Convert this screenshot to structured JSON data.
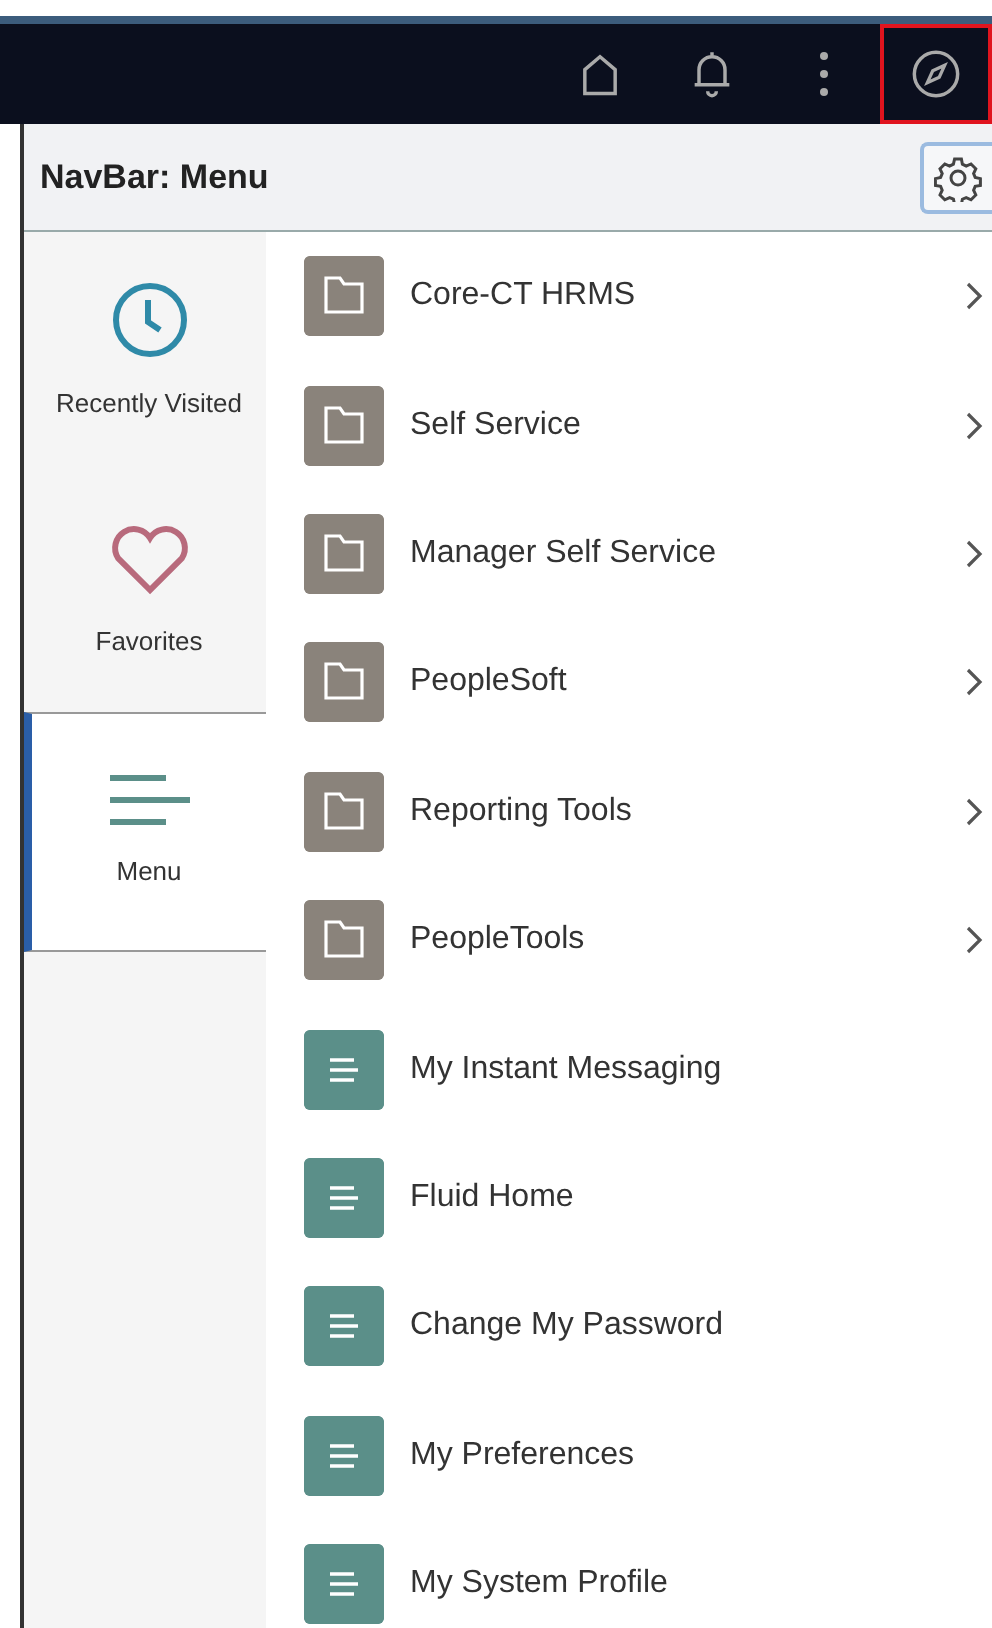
{
  "top_bar": {
    "icons": [
      {
        "kind": "home",
        "highlighted": false
      },
      {
        "kind": "bell",
        "highlighted": false
      },
      {
        "kind": "more",
        "highlighted": false
      },
      {
        "kind": "compass",
        "highlighted": true
      }
    ]
  },
  "header": {
    "title": "NavBar: Menu"
  },
  "sidebar": {
    "items": [
      {
        "kind": "clock",
        "label": "Recently Visited",
        "selected": false
      },
      {
        "kind": "heart",
        "label": "Favorites",
        "selected": false
      },
      {
        "kind": "menu",
        "label": "Menu",
        "selected": true
      }
    ]
  },
  "menu": {
    "items": [
      {
        "kind": "folder",
        "label": "Core-CT HRMS"
      },
      {
        "kind": "folder",
        "label": "Self Service"
      },
      {
        "kind": "folder",
        "label": "Manager Self Service"
      },
      {
        "kind": "folder",
        "label": "PeopleSoft"
      },
      {
        "kind": "folder",
        "label": "Reporting Tools"
      },
      {
        "kind": "folder",
        "label": "PeopleTools"
      },
      {
        "kind": "page",
        "label": "My Instant Messaging"
      },
      {
        "kind": "page",
        "label": "Fluid Home"
      },
      {
        "kind": "page",
        "label": "Change My Password"
      },
      {
        "kind": "page",
        "label": "My Preferences"
      },
      {
        "kind": "page",
        "label": "My System Profile"
      }
    ]
  }
}
